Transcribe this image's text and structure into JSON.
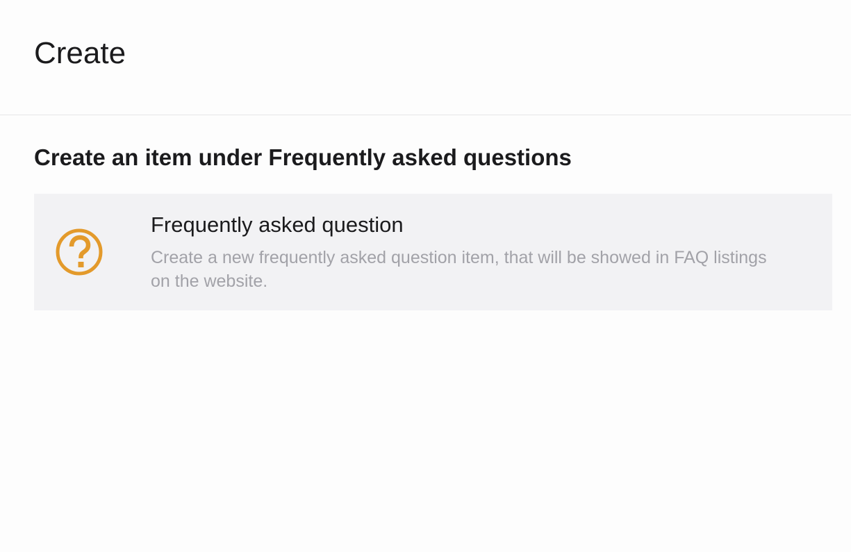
{
  "header": {
    "title": "Create"
  },
  "section": {
    "heading": "Create an item under Frequently asked questions"
  },
  "options": [
    {
      "title": "Frequently asked question",
      "description": "Create a new frequently asked question item, that will be showed in FAQ listings on the website.",
      "icon": "question-circle-icon",
      "icon_color": "#e39a2b"
    }
  ]
}
